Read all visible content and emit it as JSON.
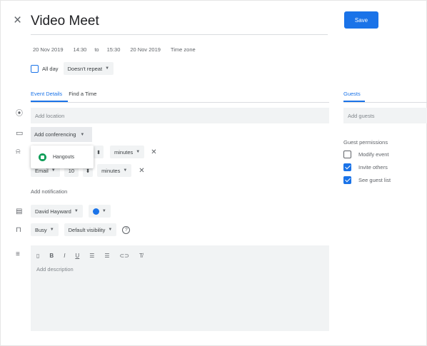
{
  "header": {
    "close_glyph": "×",
    "title": "Video Meet",
    "save_label": "Save"
  },
  "datetime": {
    "start_date": "20 Nov 2019",
    "start_time": "14:30",
    "to_label": "to",
    "end_time": "15:30",
    "end_date": "20 Nov 2019",
    "time_zone_label": "Time zone"
  },
  "options": {
    "all_day_label": "All day",
    "repeat_value": "Doesn't repeat"
  },
  "tabs": {
    "event_details": "Event Details",
    "find_a_time": "Find a Time",
    "guests": "Guests"
  },
  "fields": {
    "location_placeholder": "Add location",
    "conferencing_label": "Add conferencing",
    "guests_placeholder": "Add guests"
  },
  "conferencing_menu": {
    "option": "Hangouts"
  },
  "notifications": {
    "row1_units": "minutes",
    "row2_method": "Email",
    "row2_value": "10",
    "row2_units": "minutes",
    "add_label": "Add notification"
  },
  "calendar": {
    "owner": "David Hayward",
    "color": "#1a73e8"
  },
  "visibility": {
    "status": "Busy",
    "visibility": "Default visibility",
    "help_glyph": "?"
  },
  "description": {
    "placeholder": "Add description"
  },
  "guest_permissions": {
    "heading": "Guest permissions",
    "items": [
      {
        "label": "Modify event",
        "checked": false
      },
      {
        "label": "Invite others",
        "checked": true
      },
      {
        "label": "See guest list",
        "checked": true
      }
    ]
  },
  "colors": {
    "accent": "#1a73e8",
    "field_bg": "#f1f3f4",
    "hangouts_green": "#0f9d58"
  }
}
